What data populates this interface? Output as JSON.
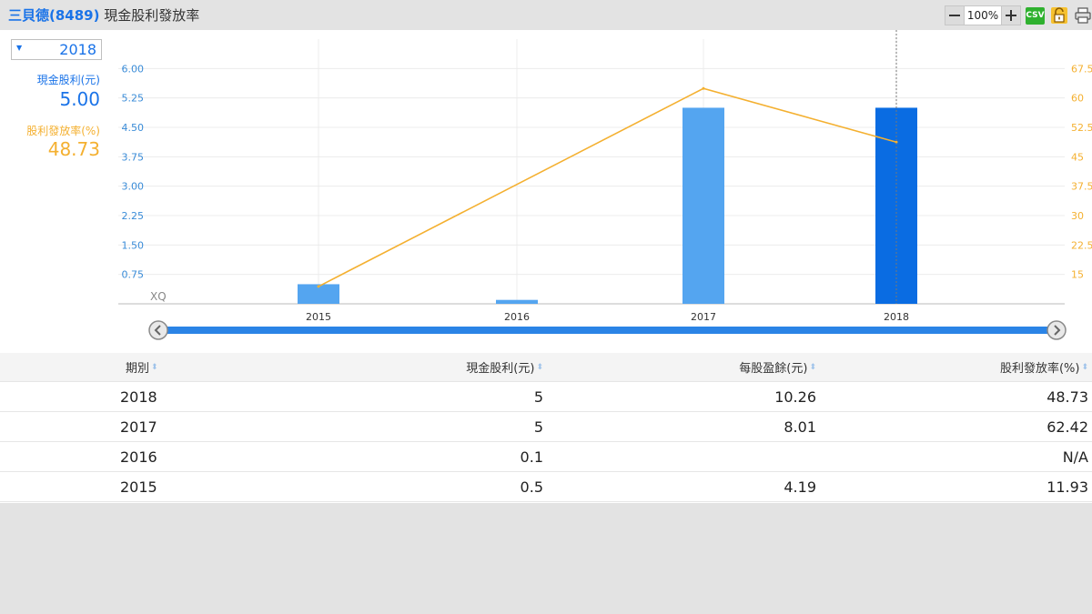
{
  "header": {
    "stock_name": "三貝德(8489)",
    "page_title": "現金股利發放率"
  },
  "toolbar": {
    "zoom_out_icon": "minus-icon",
    "zoom": "100%",
    "zoom_in_icon": "plus-icon",
    "csv": "CSV",
    "lock_icon": "lock-icon",
    "print_icon": "printer-icon"
  },
  "sidebar": {
    "year_selected": "2018",
    "cash_dividend_label": "現金股利(元)",
    "cash_dividend_value": "5.00",
    "payout_label": "股利發放率(%)",
    "payout_value": "48.73"
  },
  "colors": {
    "bar": "#54a5f0",
    "bar_selected": "#0a6ce2",
    "line": "#f4b030",
    "left_axis": "#3a8cd8",
    "right_axis": "#f4b030",
    "scrollbar": "#2b84e6"
  },
  "chart_data": {
    "type": "bar",
    "categories": [
      "2015",
      "2016",
      "2017",
      "2018"
    ],
    "series": [
      {
        "name": "現金股利(元)",
        "type": "bar",
        "axis": "left",
        "values": [
          0.5,
          0.1,
          5,
          5
        ]
      },
      {
        "name": "股利發放率(%)",
        "type": "line",
        "axis": "right",
        "values": [
          11.93,
          null,
          62.42,
          48.73
        ]
      }
    ],
    "left_ticks": [
      "0.75",
      "1.50",
      "2.25",
      "3.00",
      "3.75",
      "4.50",
      "5.25",
      "6.00"
    ],
    "right_ticks": [
      "15",
      "22.5",
      "30",
      "37.5",
      "45",
      "52.5",
      "60",
      "67.5"
    ],
    "left_range": [
      0,
      6.75
    ],
    "right_range": [
      7.5,
      75
    ],
    "selected_category": "2018",
    "watermark": "XQ",
    "grid": true
  },
  "table": {
    "headers": [
      "期別",
      "現金股利(元)",
      "每股盈餘(元)",
      "股利發放率(%)"
    ],
    "rows": [
      [
        "2018",
        "5",
        "10.26",
        "48.73"
      ],
      [
        "2017",
        "5",
        "8.01",
        "62.42"
      ],
      [
        "2016",
        "0.1",
        "",
        "N/A"
      ],
      [
        "2015",
        "0.5",
        "4.19",
        "11.93"
      ]
    ]
  }
}
